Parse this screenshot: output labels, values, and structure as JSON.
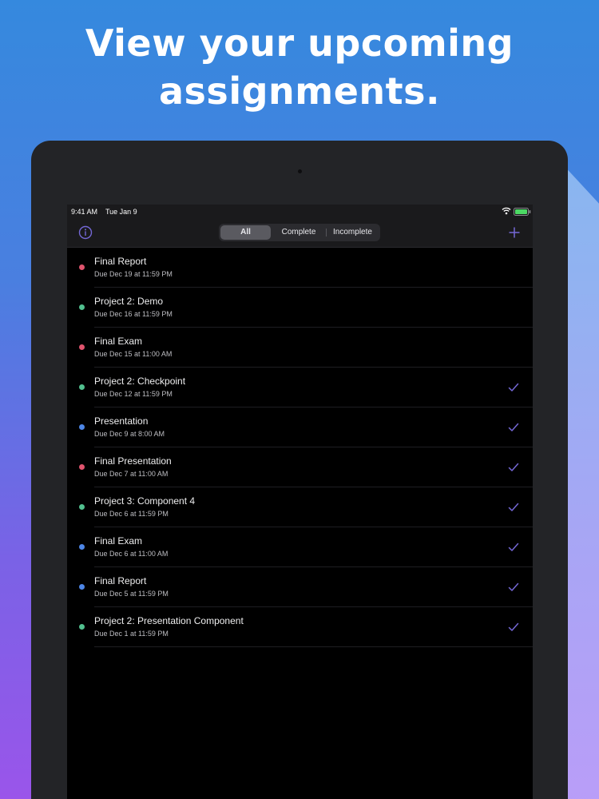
{
  "headline": {
    "line1": "View your upcoming",
    "line2": "assignments."
  },
  "status_bar": {
    "time": "9:41 AM",
    "date": "Tue Jan 9"
  },
  "nav": {
    "segments": [
      "All",
      "Complete",
      "Incomplete"
    ],
    "selected_segment": "All"
  },
  "colors": {
    "red": "#e0546e",
    "green": "#52c08f",
    "blue": "#4d86e6",
    "accent": "#7468d6"
  },
  "assignments": [
    {
      "title": "Final Report",
      "due": "Due Dec 19 at 11:59 PM",
      "color": "red",
      "completed": false
    },
    {
      "title": "Project 2: Demo",
      "due": "Due Dec 16 at 11:59 PM",
      "color": "green",
      "completed": false
    },
    {
      "title": "Final Exam",
      "due": "Due Dec 15 at 11:00 AM",
      "color": "red",
      "completed": false
    },
    {
      "title": "Project 2: Checkpoint",
      "due": "Due Dec 12 at 11:59 PM",
      "color": "green",
      "completed": true
    },
    {
      "title": "Presentation",
      "due": "Due Dec 9 at 8:00 AM",
      "color": "blue",
      "completed": true
    },
    {
      "title": "Final Presentation",
      "due": "Due Dec 7 at 11:00 AM",
      "color": "red",
      "completed": true
    },
    {
      "title": "Project 3: Component 4",
      "due": "Due Dec 6 at 11:59 PM",
      "color": "green",
      "completed": true
    },
    {
      "title": "Final Exam",
      "due": "Due Dec 6 at 11:00 AM",
      "color": "blue",
      "completed": true
    },
    {
      "title": "Final Report",
      "due": "Due Dec 5 at 11:59 PM",
      "color": "blue",
      "completed": true
    },
    {
      "title": "Project 2: Presentation Component",
      "due": "Due Dec 1 at 11:59 PM",
      "color": "green",
      "completed": true
    }
  ]
}
